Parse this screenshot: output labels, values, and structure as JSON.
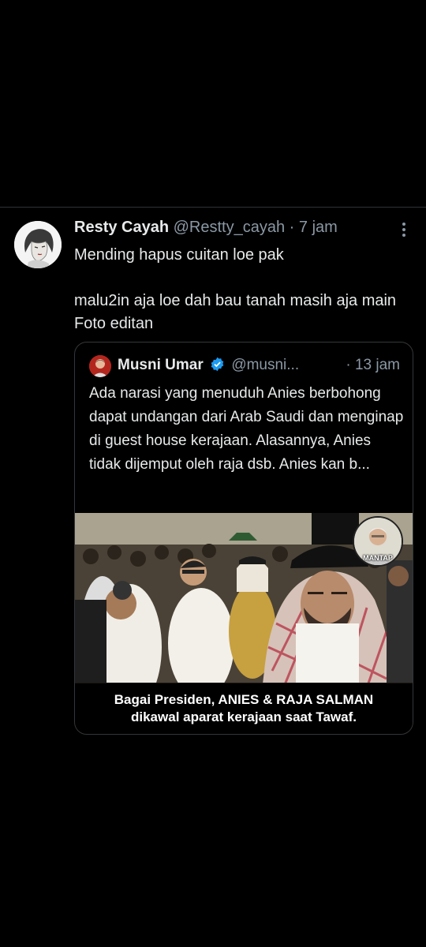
{
  "tweet": {
    "name": "Resty Cayah",
    "handle": "@Restty_cayah",
    "time": "7 jam",
    "separator": "·",
    "text": "Mending hapus cuitan loe pak\n\nmalu2in aja loe  dah bau tanah  masih aja main  Foto editan",
    "more_icon": "more-vertical-icon",
    "avatar_icon": "avatar-sketch-portrait"
  },
  "quoted": {
    "name": "Musni Umar",
    "handle": "@musni...",
    "time": "· 13 jam",
    "verified_icon": "verified-badge-icon",
    "verified_color": "#1d9bf0",
    "text": "Ada narasi yang menuduh Anies berbohong  dapat undangan dari Arab Saudi dan menginap di guest house kerajaan.  Alasannya,  Anies tidak dijemput oleh raja dsb.  Anies kan b...",
    "image": {
      "badge_label": "MANTAP",
      "caption_line1": "Bagai Presiden, ANIES & RAJA SALMAN",
      "caption_line2": "dikawal aparat kerajaan saat Tawaf."
    }
  },
  "colors": {
    "background": "#000000",
    "text": "#e7e9ea",
    "secondary": "#8b98a5",
    "border": "#2f3336"
  }
}
